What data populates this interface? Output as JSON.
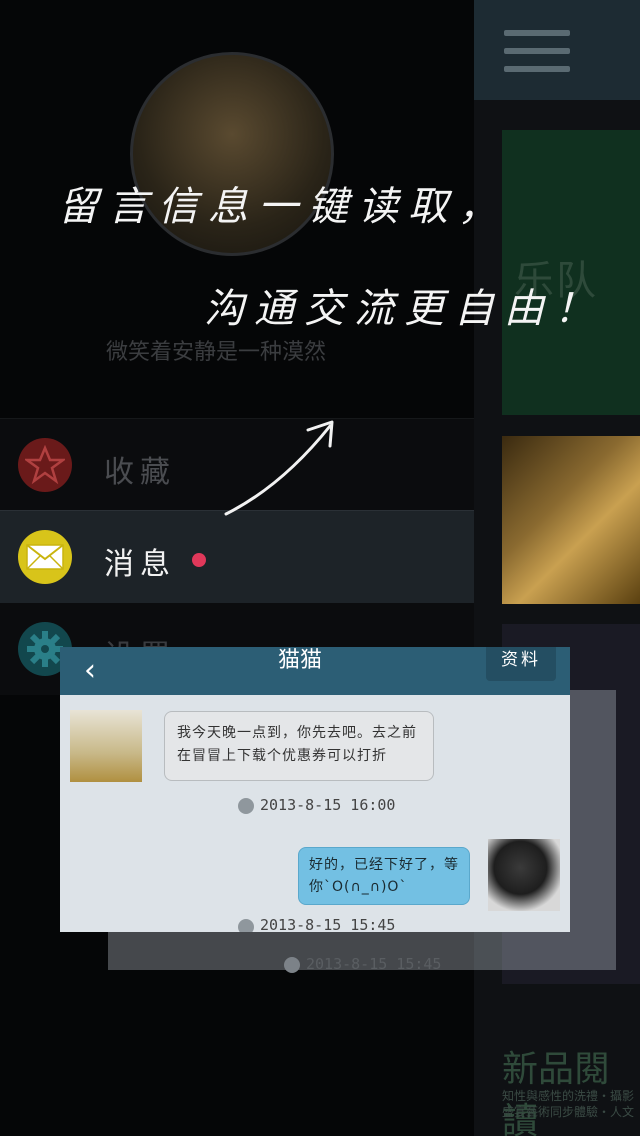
{
  "drawer": {
    "signature": "微笑着安静是一种漠然",
    "menu": [
      {
        "label": "收藏",
        "icon": "star-icon",
        "color": "#8a2222"
      },
      {
        "label": "消息",
        "icon": "envelope-icon",
        "color": "#d8c41a",
        "has_unread": true
      },
      {
        "label": "设置",
        "icon": "gear-icon",
        "color": "#1f6f78"
      }
    ]
  },
  "overlay": {
    "line1": "留言信息一键读取，",
    "line2": "沟通交流更自由！"
  },
  "background": {
    "band_text": "乐队",
    "new_books": "新品閱讀",
    "new_books_sub": "知性與感性的洗禮・攝影 盛宴藝術同步體驗・人文"
  },
  "chat": {
    "title": "猫猫",
    "profile_button": "资料",
    "messages": [
      {
        "side": "left",
        "text": "我今天晚一点到，你先去吧。去之前在冒冒上下载个优惠券可以打折",
        "time": "2013-8-15 16:00"
      },
      {
        "side": "right",
        "text": "好的，已经下好了，等你`O(∩_∩)O`",
        "time": "2013-8-15 15:45"
      }
    ],
    "ghost_time": "2013-8-15 15:45"
  }
}
